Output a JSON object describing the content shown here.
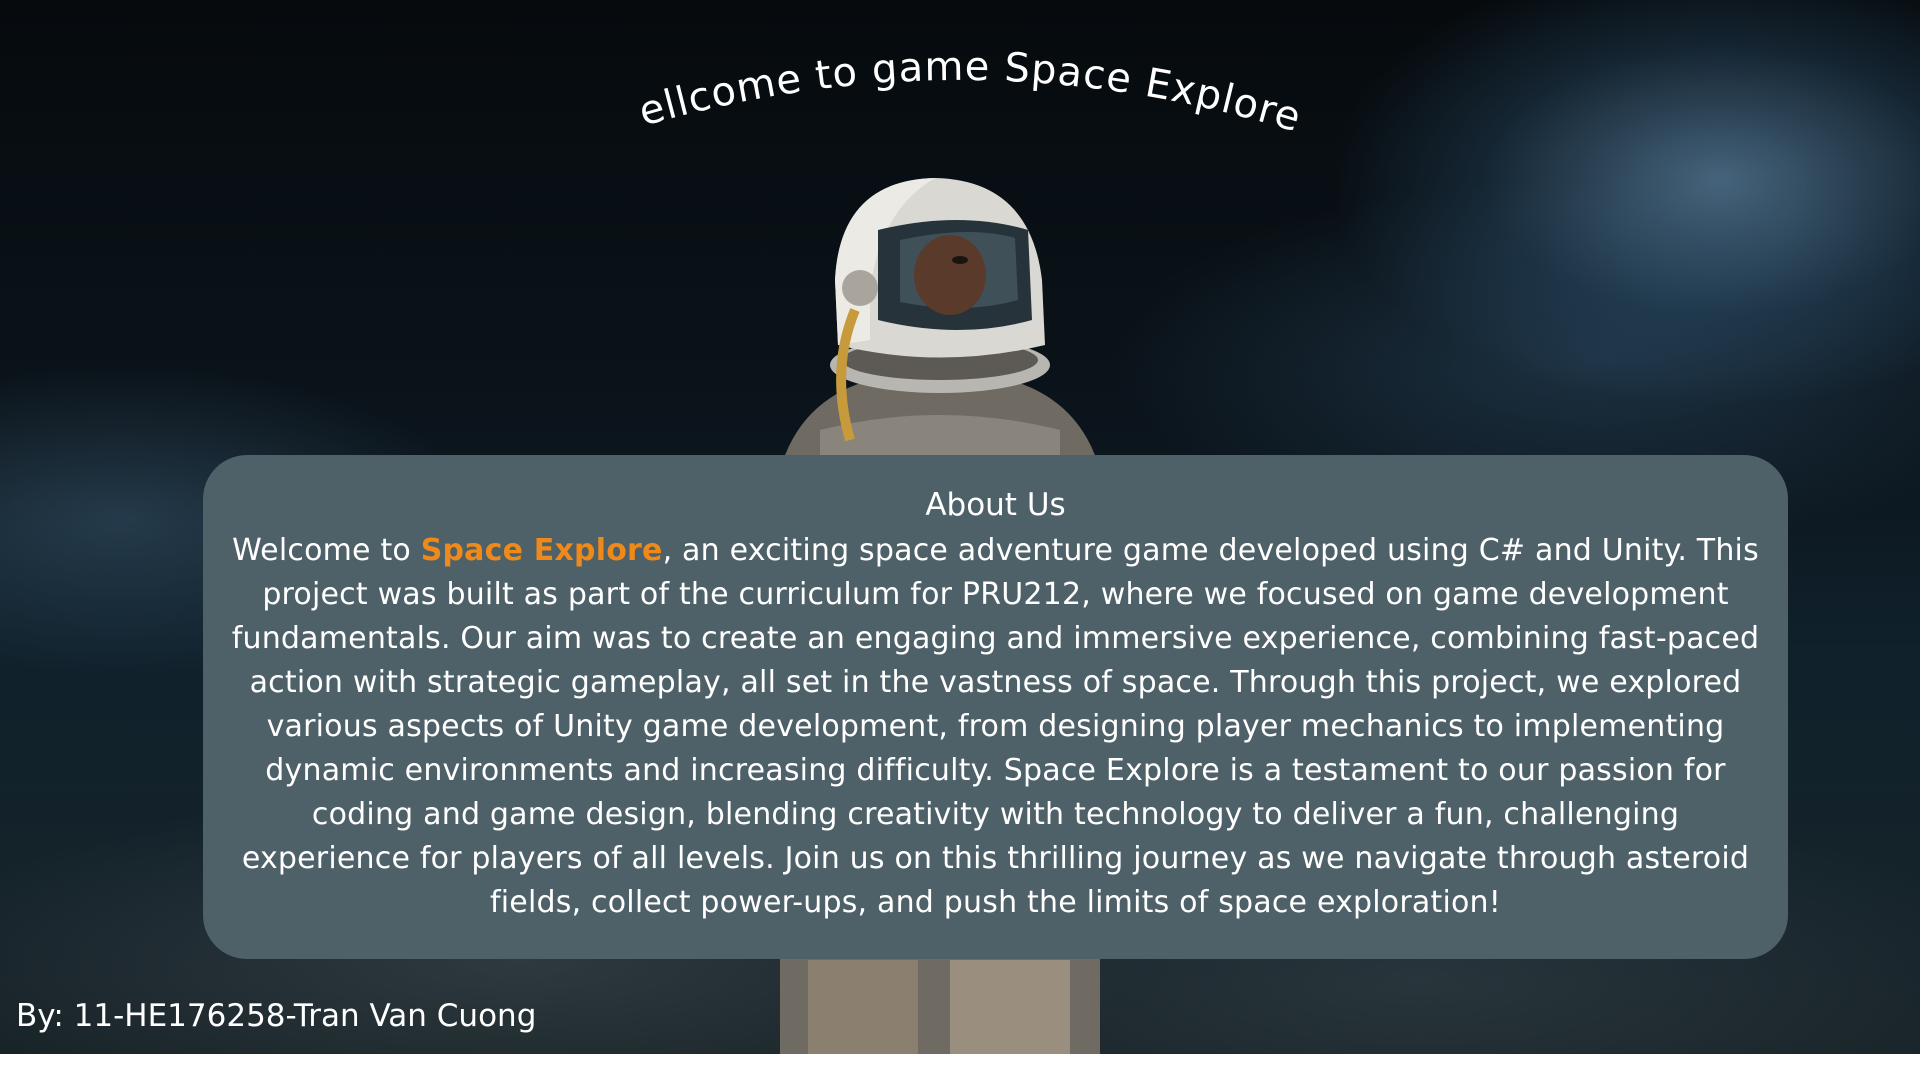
{
  "page": {
    "title": "Wellcome to game Space Explorer"
  },
  "about": {
    "heading": "About Us",
    "intro": "Welcome to ",
    "brand": "Space Explore",
    "body": ", an exciting space adventure game developed using C# and Unity. This project was built as part of the curriculum for PRU212, where we focused on game development fundamentals. Our aim was to create an engaging and immersive experience, combining fast-paced action with strategic gameplay, all set in the vastness of space. Through this project, we explored various aspects of Unity game development, from designing player mechanics to implementing dynamic environments and increasing difficulty. Space Explore is a testament to our passion for coding and game design, blending creativity with technology to deliver a fun, challenging experience for players of all levels. Join us on this thrilling journey as we navigate through asteroid fields, collect power-ups, and push the limits of space exploration!"
  },
  "footer": {
    "credit": "By: 11-HE176258-Tran Van Cuong"
  },
  "colors": {
    "card_background": "#4f6168",
    "brand_highlight": "#ef8a1a",
    "text": "#ffffff"
  },
  "images": {
    "background": "astronaut-space-smoke-photo"
  }
}
